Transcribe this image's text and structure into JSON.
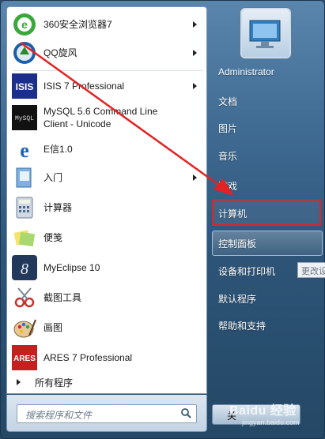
{
  "programs": [
    {
      "label": "360安全浏览器7",
      "has_submenu": true,
      "icon": "browser-360-icon"
    },
    {
      "label": "QQ旋风",
      "has_submenu": true,
      "icon": "qq-whirlwind-icon"
    },
    {
      "label": "ISIS 7 Professional",
      "has_submenu": true,
      "icon": "isis-icon"
    },
    {
      "label": "MySQL 5.6 Command Line Client - Unicode",
      "line1": "MySQL 5.6 Command Line",
      "line2": "Client - Unicode",
      "has_submenu": false,
      "icon": "mysql-icon"
    },
    {
      "label": "E信1.0",
      "has_submenu": false,
      "icon": "e-xin-icon"
    },
    {
      "label": "入门",
      "has_submenu": true,
      "icon": "getting-started-icon"
    },
    {
      "label": "计算器",
      "has_submenu": false,
      "icon": "calculator-icon"
    },
    {
      "label": "便笺",
      "has_submenu": false,
      "icon": "sticky-notes-icon"
    },
    {
      "label": "MyEclipse 10",
      "has_submenu": false,
      "icon": "myeclipse-icon"
    },
    {
      "label": "截图工具",
      "has_submenu": false,
      "icon": "snipping-tool-icon"
    },
    {
      "label": "画图",
      "has_submenu": false,
      "icon": "paint-icon"
    },
    {
      "label": "ARES 7 Professional",
      "has_submenu": false,
      "icon": "ares-icon"
    }
  ],
  "all_programs_label": "所有程序",
  "search": {
    "placeholder": "搜索程序和文件"
  },
  "right": {
    "user": "Administrator",
    "documents": "文档",
    "pictures": "图片",
    "music": "音乐",
    "games": "游戏",
    "computer": "计算机",
    "control_panel": "控制面板",
    "devices_printers": "设备和打印机",
    "default_programs": "默认程序",
    "help_support": "帮助和支持"
  },
  "tooltip_text": "更改设",
  "shutdown_label": "关",
  "watermark": "Baidu 经验",
  "watermark_sub": "jingyan.baidu.com",
  "colors": {
    "annotation_red": "#e32222",
    "window_blue": "#3f6a92"
  }
}
